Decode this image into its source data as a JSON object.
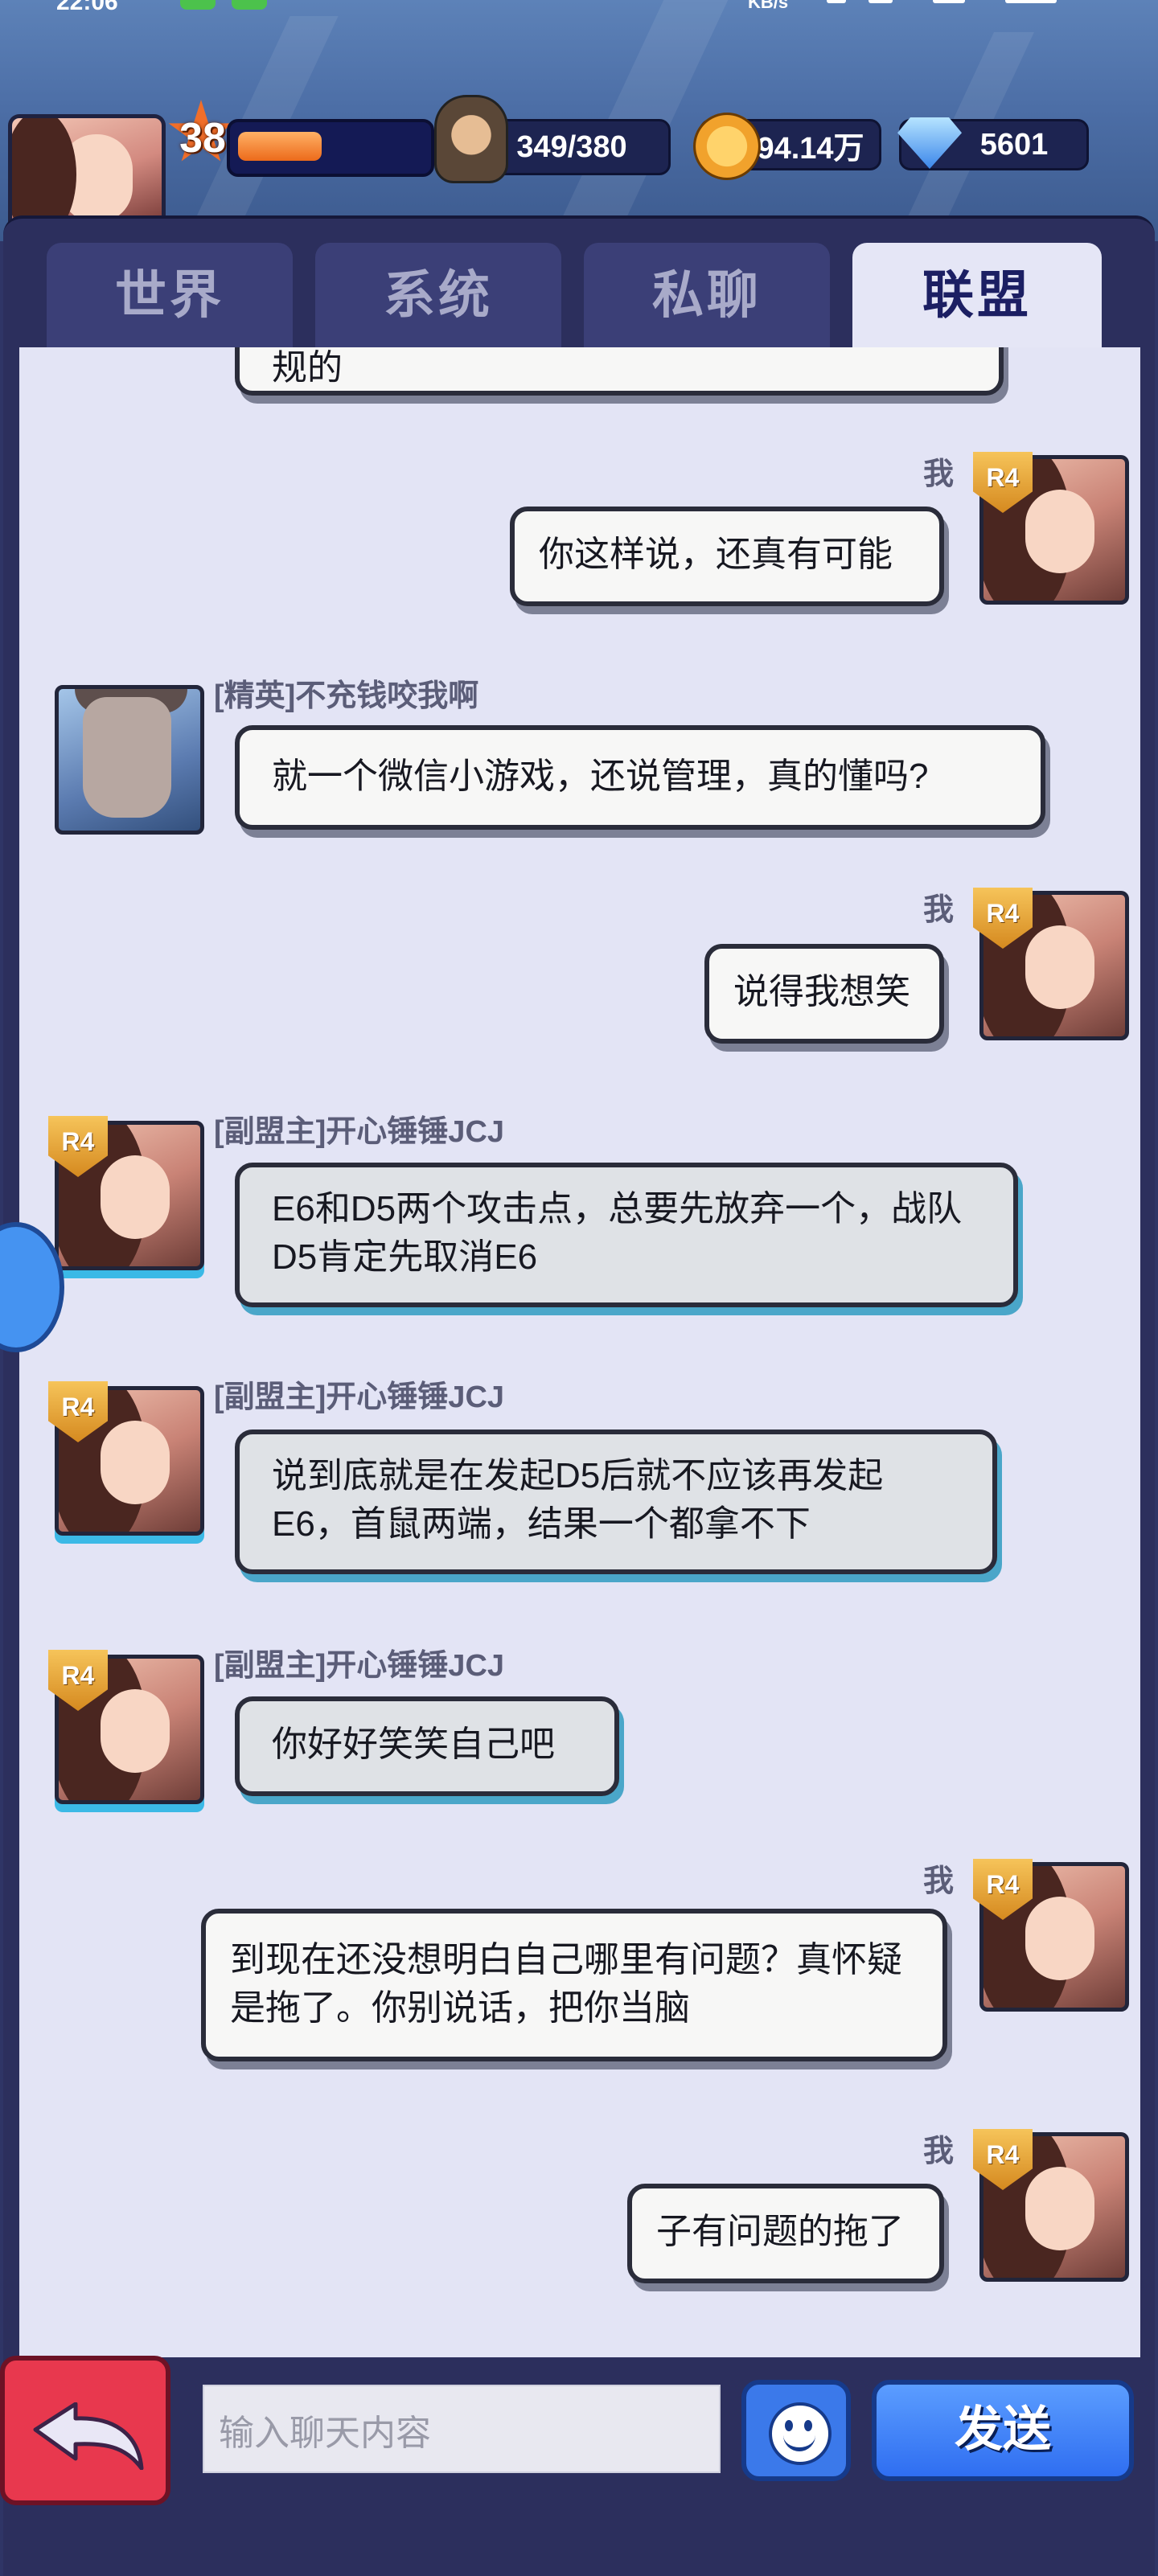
{
  "status": {
    "time": "22:06",
    "net_speed": "KB/s"
  },
  "player": {
    "level": "38",
    "xp_progress": 0.45,
    "stamina": "349/380",
    "gold": "94.14万",
    "gems": "5601"
  },
  "tabs": [
    {
      "label": "世界",
      "active": false
    },
    {
      "label": "系统",
      "active": false
    },
    {
      "label": "私聊",
      "active": false
    },
    {
      "label": "联盟",
      "active": true
    }
  ],
  "chat": {
    "partial_top_text": "规的",
    "messages": [
      {
        "sender": "我",
        "rank": "R4",
        "text": "你这样说，还真有可能"
      },
      {
        "sender": "[精英]不充钱咬我啊",
        "text": "就一个微信小游戏，还说管理，真的懂吗?"
      },
      {
        "sender": "我",
        "rank": "R4",
        "text": "说得我想笑"
      },
      {
        "sender": "[副盟主]开心锤锤JCJ",
        "rank": "R4",
        "text": "E6和D5两个攻击点，总要先放弃一个，战队D5肯定先取消E6"
      },
      {
        "sender": "[副盟主]开心锤锤JCJ",
        "rank": "R4",
        "text": "说到底就是在发起D5后就不应该再发起E6，首鼠两端，结果一个都拿不下"
      },
      {
        "sender": "[副盟主]开心锤锤JCJ",
        "rank": "R4",
        "text": "你好好笑笑自己吧"
      },
      {
        "sender": "我",
        "rank": "R4",
        "text": "到现在还没想明白自己哪里有问题？真怀疑是拖了。你别说话，把你当脑"
      },
      {
        "sender": "我",
        "rank": "R4",
        "text": "子有问题的拖了"
      }
    ]
  },
  "input": {
    "placeholder": "输入聊天内容"
  },
  "send_label": "发送",
  "colors": {
    "accent": "#3b79ea",
    "panel": "#2c2f5d",
    "chat_bg": "#e3e4f5",
    "back": "#e8384e",
    "rank_badge": "#f6c45a"
  }
}
